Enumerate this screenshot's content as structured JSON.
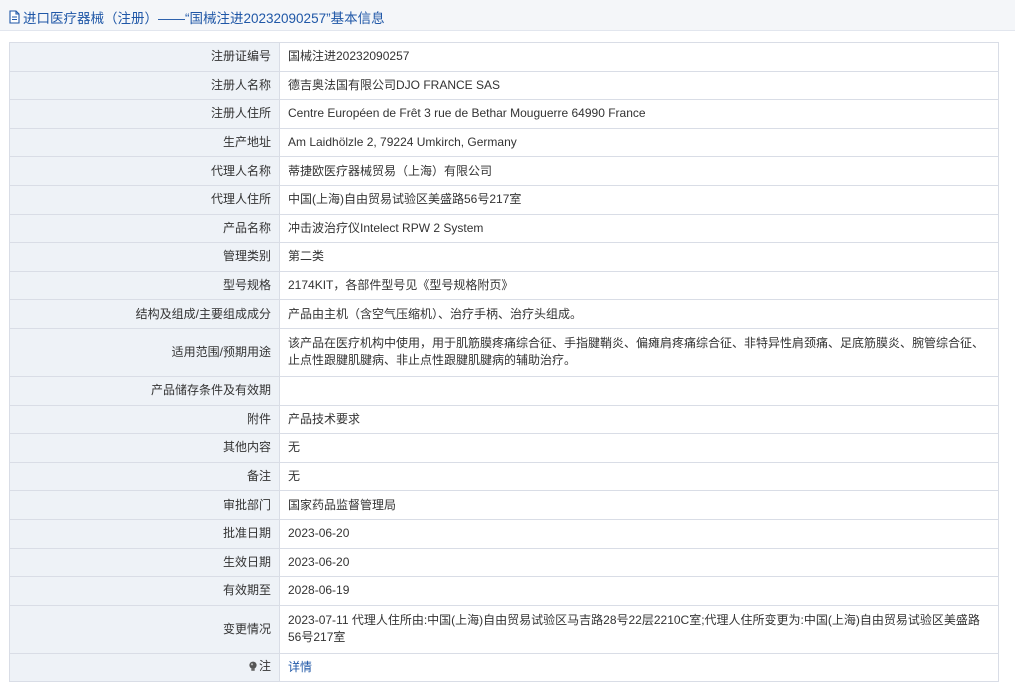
{
  "header": {
    "title": "进口医疗器械（注册）——“国械注进20232090257”基本信息",
    "icon": "document-icon"
  },
  "rows": [
    {
      "label": "注册证编号",
      "value": "国械注进20232090257"
    },
    {
      "label": "注册人名称",
      "value": "德吉奥法国有限公司DJO FRANCE SAS"
    },
    {
      "label": "注册人住所",
      "value": "Centre Européen de Frêt 3 rue de Bethar Mouguerre 64990 France"
    },
    {
      "label": "生产地址",
      "value": "Am Laidhölzle 2, 79224 Umkirch, Germany"
    },
    {
      "label": "代理人名称",
      "value": "蒂捷欧医疗器械贸易（上海）有限公司"
    },
    {
      "label": "代理人住所",
      "value": "中国(上海)自由贸易试验区美盛路56号217室"
    },
    {
      "label": "产品名称",
      "value": "冲击波治疗仪Intelect RPW 2 System"
    },
    {
      "label": "管理类别",
      "value": "第二类"
    },
    {
      "label": "型号规格",
      "value": "2174KIT，各部件型号见《型号规格附页》"
    },
    {
      "label": "结构及组成/主要组成成分",
      "value": "产品由主机（含空气压缩机）、治疗手柄、治疗头组成。"
    },
    {
      "label": "适用范围/预期用途",
      "value": "该产品在医疗机构中使用，用于肌筋膜疼痛综合征、手指腱鞘炎、偏瘫肩疼痛综合征、非特异性肩颈痛、足底筋膜炎、腕管综合征、止点性跟腱肌腱病、非止点性跟腱肌腱病的辅助治疗。"
    },
    {
      "label": "产品储存条件及有效期",
      "value": ""
    },
    {
      "label": "附件",
      "value": "产品技术要求"
    },
    {
      "label": "其他内容",
      "value": "无"
    },
    {
      "label": "备注",
      "value": "无"
    },
    {
      "label": "审批部门",
      "value": "国家药品监督管理局"
    },
    {
      "label": "批准日期",
      "value": "2023-06-20"
    },
    {
      "label": "生效日期",
      "value": "2023-06-20"
    },
    {
      "label": "有效期至",
      "value": "2028-06-19"
    },
    {
      "label": "变更情况",
      "value": "2023-07-11 代理人住所由:中国(上海)自由贸易试验区马吉路28号22层2210C室;代理人住所变更为:中国(上海)自由贸易试验区美盛路56号217室"
    }
  ],
  "note": {
    "label": "注",
    "icon": "lightbulb-icon",
    "link_text": "详情"
  }
}
